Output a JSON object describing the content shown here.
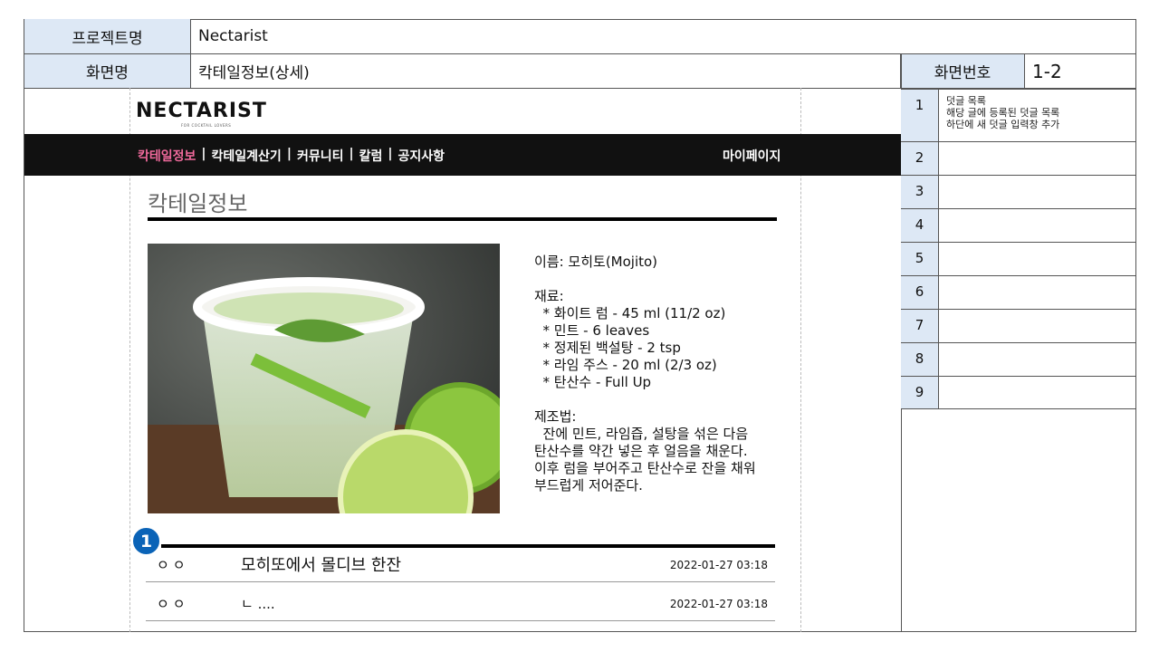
{
  "header": {
    "project_label": "프로젝트명",
    "project_value": "Nectarist",
    "screen_label": "화면명",
    "screen_value": "칵테일정보(상세)",
    "screen_no_label": "화면번호",
    "screen_no_value": "1-2"
  },
  "notes": [
    {
      "num": "1",
      "text": "덧글 목록\n해당 글에 등록된 덧글 목록\n하단에 새 덧글 입력창 추가"
    },
    {
      "num": "2",
      "text": ""
    },
    {
      "num": "3",
      "text": ""
    },
    {
      "num": "4",
      "text": ""
    },
    {
      "num": "5",
      "text": ""
    },
    {
      "num": "6",
      "text": ""
    },
    {
      "num": "7",
      "text": ""
    },
    {
      "num": "8",
      "text": ""
    },
    {
      "num": "9",
      "text": ""
    }
  ],
  "site": {
    "logo": "NECTARIST",
    "logo_sub": "FOR COCKTAIL LOVERS",
    "nav": [
      "칵테일정보",
      "칵테일계산기",
      "커뮤니티",
      "칼럼",
      "공지사항"
    ],
    "nav_sep": "|",
    "mypage": "마이페이지",
    "page_title": "칵테일정보"
  },
  "cocktail": {
    "info": "이름: 모히토(Mojito)\n\n재료:\n  * 화이트 럼 - 45 ml (11/2 oz)\n  * 민트 - 6 leaves\n  * 정제된 백설탕 - 2 tsp\n  * 라임 주스 - 20 ml (2/3 oz)\n  * 탄산수 - Full Up\n\n제조법:\n  잔에 민트, 라임즙, 설탕을 섞은 다음\n탄산수를 약간 넣은 후 얼음을 채운다.\n이후 럼을 부어주고 탄산수로 잔을 채워\n부드럽게 저어준다."
  },
  "badge": "1",
  "comments": [
    {
      "user": "ㅇㅇ",
      "text": "모히또에서 몰디브 한잔",
      "date": "2022-01-27  03:18"
    },
    {
      "user": "ㅇㅇ",
      "text": "ㄴ ....",
      "date": "2022-01-27  03:18"
    }
  ]
}
